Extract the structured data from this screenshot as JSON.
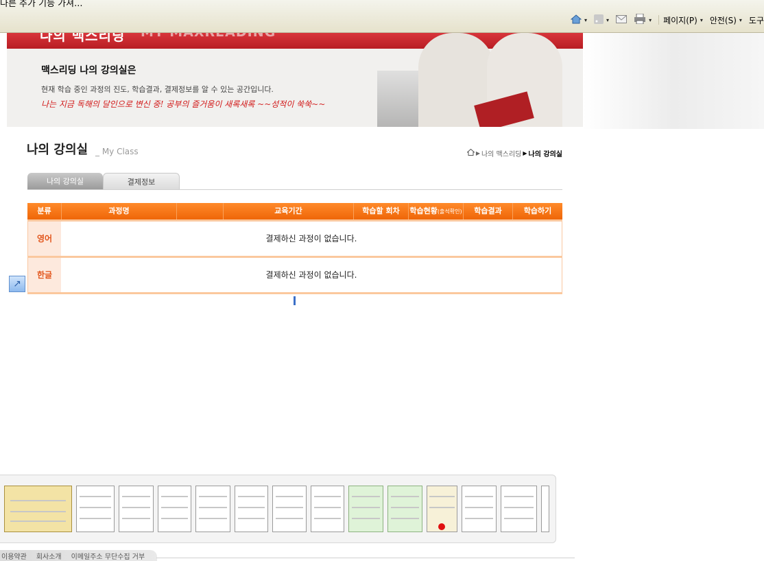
{
  "browser": {
    "addon_text": "다른 추가 기능 가져...",
    "pagemenu_label": "페이지(P)",
    "safety_label": "안전(S)",
    "tools_label": "도구"
  },
  "banner": {
    "title_ko": "나의 맥스리딩",
    "title_en": "MY MAXREADING",
    "heading": "맥스리딩 나의 강의실은",
    "description": "현재 학습 중인 과정의 진도, 학습결과, 결제정보를 알 수 있는 공간입니다.",
    "slogan": "나는 지금 독해의 달인으로 변신 중! 공부의 즐거움이 새록새록 ~~성적이 쑥쑥~~"
  },
  "page": {
    "title": "나의 강의실",
    "subtitle": "_ My Class",
    "breadcrumb": [
      "나의 맥스리딩",
      "나의 강의실"
    ]
  },
  "tabs": [
    {
      "label": "나의 강의실",
      "active": true
    },
    {
      "label": "결제정보",
      "active": false
    }
  ],
  "table": {
    "headers": [
      "분류",
      "과정명",
      "",
      "교육기간",
      "학습할 회차",
      "학습현황",
      "(출석확인)",
      "학습결과",
      "학습하기"
    ],
    "rows": [
      {
        "category": "영어",
        "message": "결제하신 과정이 없습니다."
      },
      {
        "category": "한글",
        "message": "결제하신 과정이 없습니다."
      }
    ]
  },
  "footer": {
    "links": [
      "이용약관",
      "회사소개",
      "이메일주소 무단수집 거부"
    ]
  },
  "colors": {
    "accent_orange": "#ef6608",
    "banner_red": "#c0242a",
    "category_text": "#e2551b"
  }
}
